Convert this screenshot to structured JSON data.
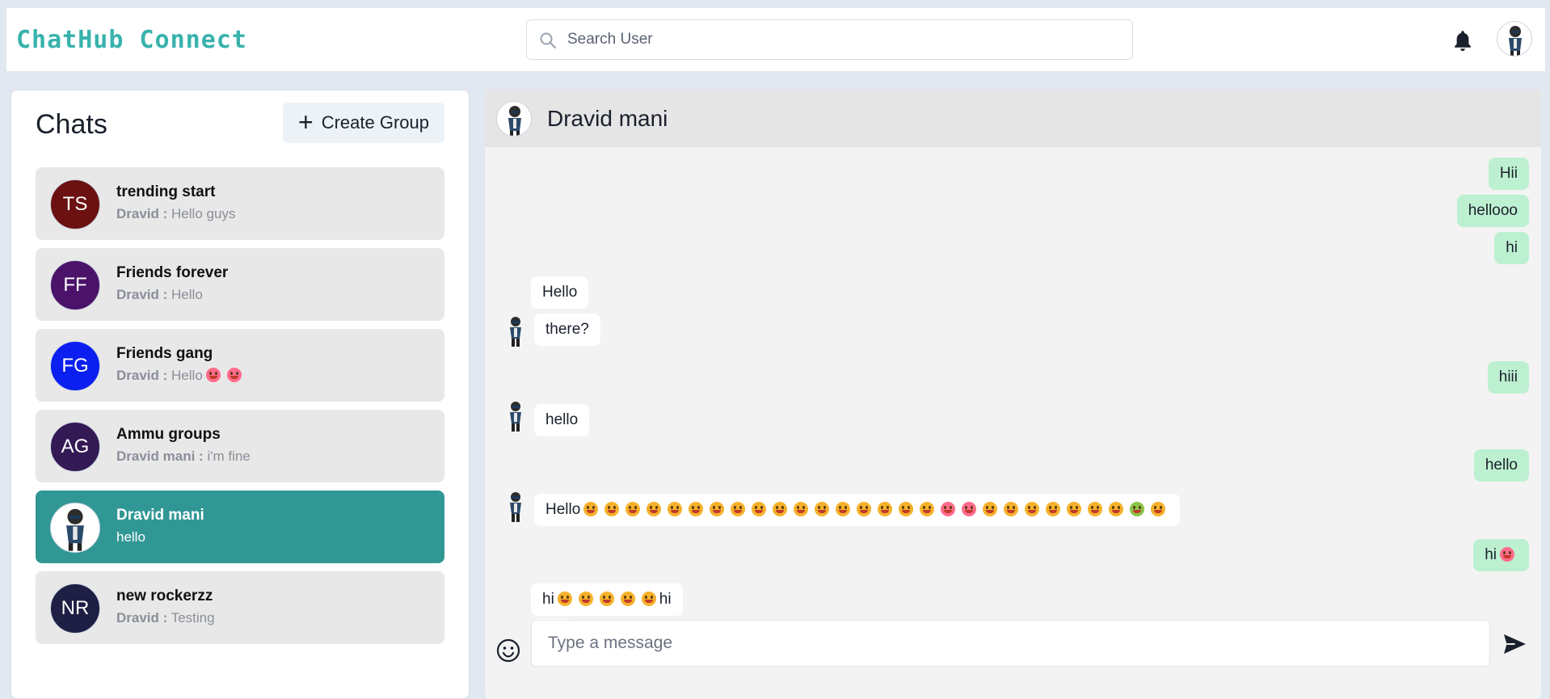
{
  "header": {
    "brand": "ChatHub Connect",
    "search_placeholder": "Search User",
    "notification_icon": "bell-icon",
    "profile_icon": "avatar"
  },
  "colors": {
    "brand": "#38b2ac",
    "active_chat": "#319795",
    "outgoing_bubble": "#bdf0d0",
    "incoming_bubble": "#ffffff"
  },
  "sidebar": {
    "title": "Chats",
    "create_group_label": "Create Group",
    "chats": [
      {
        "initials": "TS",
        "name": "trending start",
        "sender": "Dravid :",
        "message": "Hello guys",
        "color": "#6b1111"
      },
      {
        "initials": "FF",
        "name": "Friends forever",
        "sender": "Dravid :",
        "message": "Hello",
        "color": "#4a1269"
      },
      {
        "initials": "FG",
        "name": "Friends gang",
        "sender": "Dravid :",
        "message": "Hello",
        "color": "#0a1ff0"
      },
      {
        "initials": "AG",
        "name": "Ammu groups",
        "sender": "Dravid mani :",
        "message": "i'm fine",
        "color": "#341a55"
      },
      {
        "initials": "",
        "name": "Dravid mani",
        "sender": "",
        "message": "hello",
        "color": "#ffffff",
        "active": true
      },
      {
        "initials": "NR",
        "name": "new rockerzz",
        "sender": "Dravid :",
        "message": "Testing",
        "color": "#1f1f45"
      }
    ]
  },
  "chat": {
    "contact_name": "Dravid mani",
    "messages": [
      {
        "direction": "out",
        "text": "Hii"
      },
      {
        "direction": "out",
        "text": "hellooo"
      },
      {
        "direction": "out",
        "text": "hi"
      },
      {
        "direction": "in",
        "text": "Hello"
      },
      {
        "direction": "in",
        "text": "there?"
      },
      {
        "direction": "out",
        "text": "hiii"
      },
      {
        "direction": "in",
        "text": "hello"
      },
      {
        "direction": "out",
        "text": "hello"
      },
      {
        "direction": "in",
        "text": "Hello"
      },
      {
        "direction": "out",
        "text": "hi"
      },
      {
        "direction": "in",
        "text": "hi"
      },
      {
        "direction": "in",
        "text": "hi"
      }
    ],
    "composer_placeholder": "Type a message"
  }
}
